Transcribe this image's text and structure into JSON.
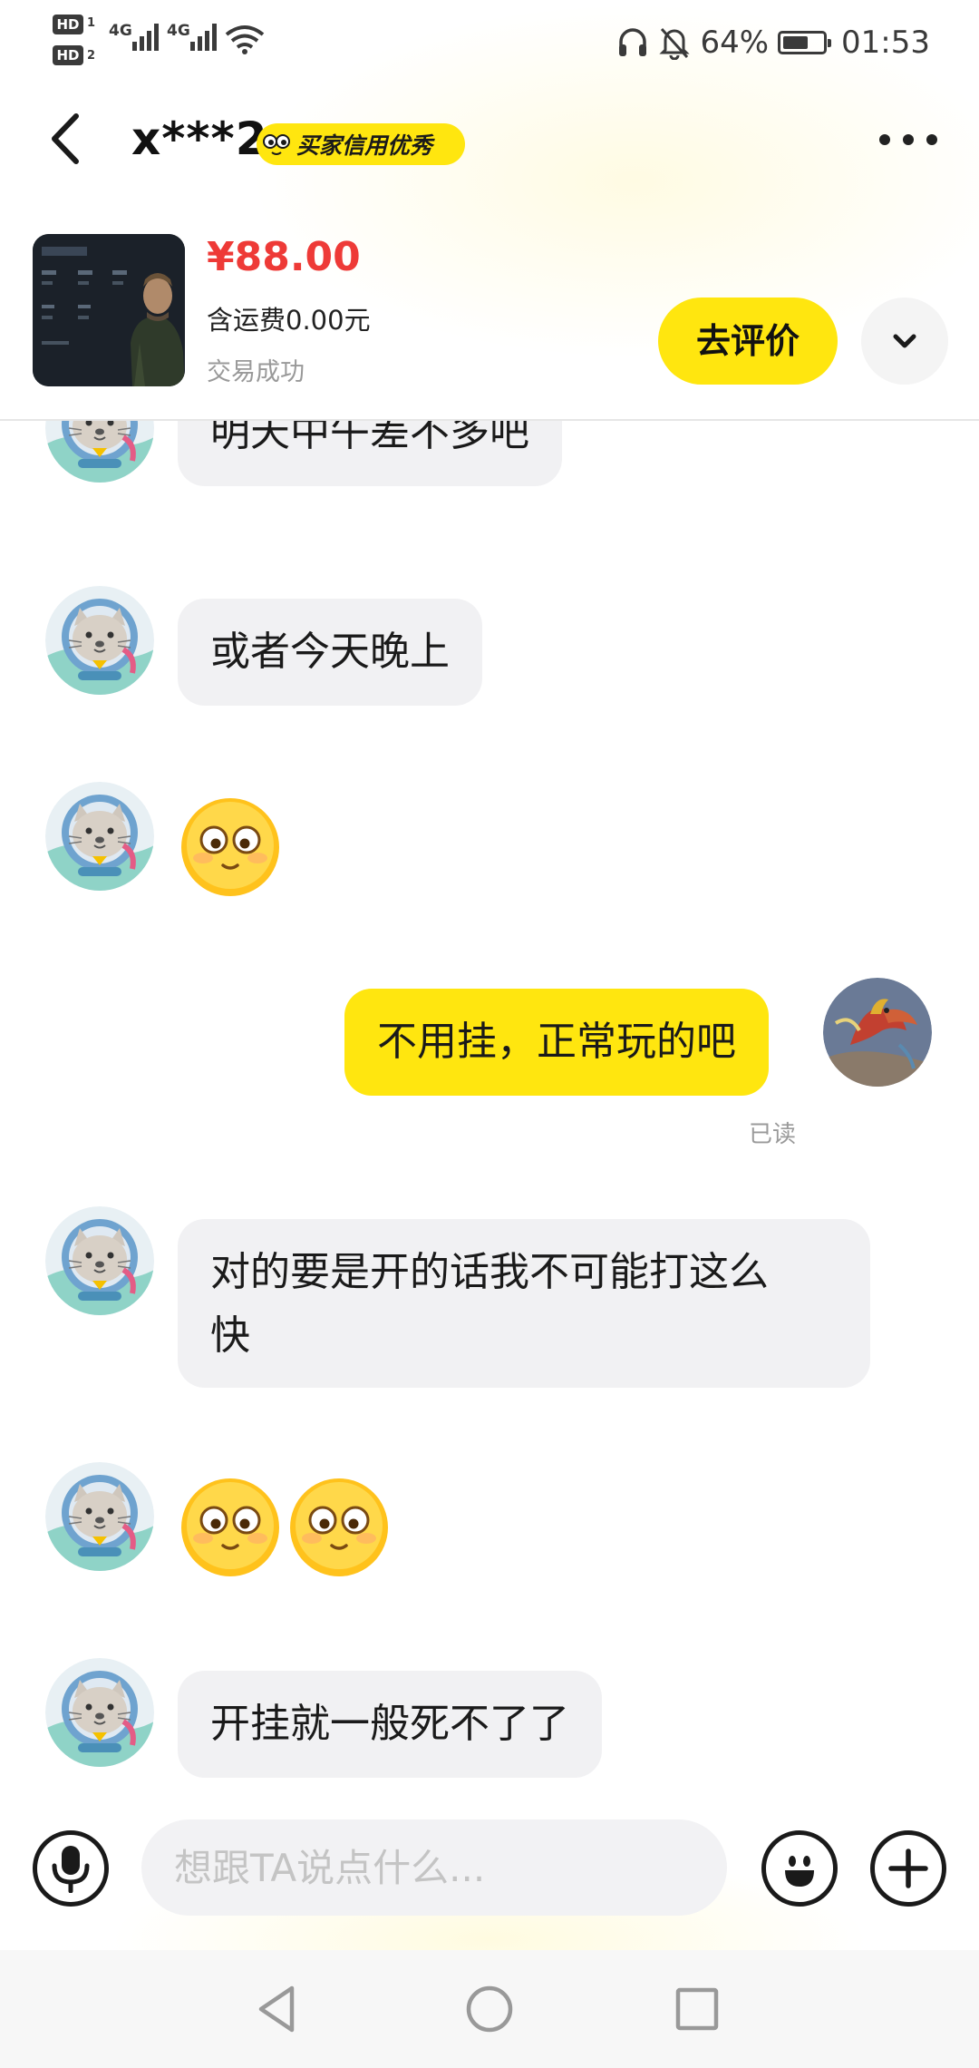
{
  "status_bar": {
    "network_1": "4G",
    "network_2": "4G",
    "battery": "64%",
    "battery_level": 0.64,
    "time": "01:53"
  },
  "header": {
    "peer_name": "x***2",
    "credit_badge": "买家信用优秀"
  },
  "order": {
    "price": "¥88.00",
    "shipping": "含运费0.00元",
    "status": "交易成功",
    "review_button": "去评价"
  },
  "messages": [
    {
      "from": "peer",
      "type": "text",
      "text": "明天中午差不多吧"
    },
    {
      "from": "peer",
      "type": "text",
      "text": "或者今天晚上"
    },
    {
      "from": "peer",
      "type": "emoji",
      "count": 1
    },
    {
      "from": "me",
      "type": "text",
      "text": "不用挂，正常玩的吧",
      "read_status": "已读"
    },
    {
      "from": "peer",
      "type": "text",
      "line1": "对的要是开的话我不可能打这么",
      "line2": "快"
    },
    {
      "from": "peer",
      "type": "emoji",
      "count": 2
    },
    {
      "from": "peer",
      "type": "text",
      "text": "开挂就一般死不了了"
    }
  ],
  "input": {
    "placeholder": "想跟TA说点什么..."
  },
  "icons": {
    "back": "back-arrow-icon",
    "more": "more-dots-icon",
    "expand": "chevron-down-icon",
    "voice": "microphone-icon",
    "emoji": "smiley-icon",
    "plus": "plus-icon",
    "nav_back": "triangle-back-icon",
    "nav_home": "circle-home-icon",
    "nav_recent": "square-recent-icon"
  },
  "colors": {
    "accent_yellow": "#ffe60f",
    "price_red": "#ee3a37",
    "peer_bubble": "#f1f1f3"
  }
}
